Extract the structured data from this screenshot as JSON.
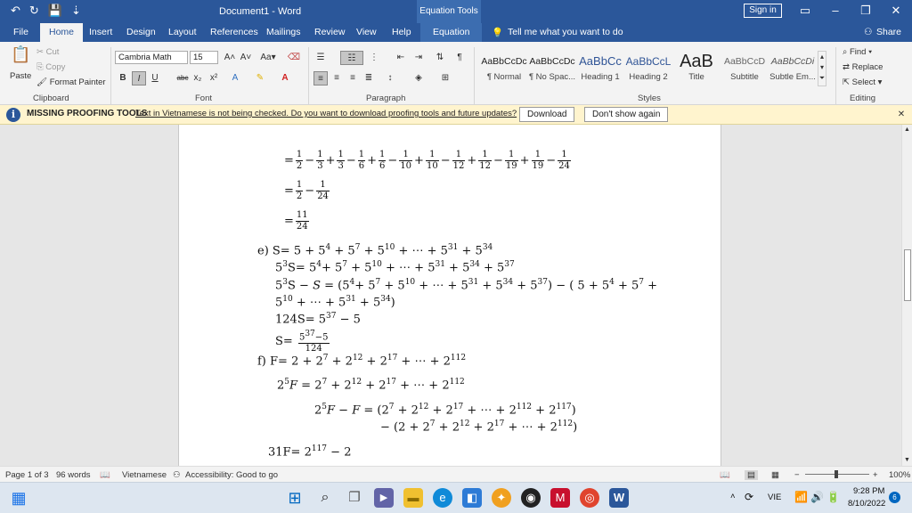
{
  "window": {
    "title": "Document1  -  Word",
    "context_tab": "Equation Tools",
    "signin": "Sign in",
    "qa": [
      "↶",
      "↻",
      "💾",
      "⇣"
    ]
  },
  "tabs": [
    "File",
    "Home",
    "Insert",
    "Design",
    "Layout",
    "References",
    "Mailings",
    "Review",
    "View",
    "Help",
    "Equation"
  ],
  "tellme": "Tell me what you want to do",
  "share": "Share",
  "ribbon": {
    "clipboard": {
      "paste": "Paste",
      "cut": "Cut",
      "copy": "Copy",
      "format_painter": "Format Painter",
      "label": "Clipboard"
    },
    "font": {
      "name": "Cambria Math",
      "size": "15",
      "label": "Font"
    },
    "paragraph": {
      "label": "Paragraph"
    },
    "styles": {
      "label": "Styles",
      "items": [
        {
          "preview": "AaBbCcDc",
          "name": "¶ Normal"
        },
        {
          "preview": "AaBbCcDc",
          "name": "¶ No Spac..."
        },
        {
          "preview": "AaBbCc",
          "name": "Heading 1"
        },
        {
          "preview": "AaBbCcL",
          "name": "Heading 2"
        },
        {
          "preview": "AaB",
          "name": "Title"
        },
        {
          "preview": "AaBbCcD",
          "name": "Subtitle"
        },
        {
          "preview": "AaBbCcDi",
          "name": "Subtle Em..."
        }
      ]
    },
    "editing": {
      "label": "Editing",
      "find": "Find",
      "replace": "Replace",
      "select": "Select"
    }
  },
  "infobar": {
    "title": "MISSING PROOFING TOOLS",
    "message": "Text in Vietnamese is not being checked. Do you want to download proofing tools and future updates?",
    "download": "Download",
    "dont_show": "Don't show again"
  },
  "document": {
    "eq_line1_prefix": "=",
    "eq_line1_fracs": [
      [
        "1",
        "2",
        "−"
      ],
      [
        "1",
        "3",
        "+"
      ],
      [
        "1",
        "3",
        "−"
      ],
      [
        "1",
        "6",
        "+"
      ],
      [
        "1",
        "6",
        "−"
      ],
      [
        "1",
        "10",
        "+"
      ],
      [
        "1",
        "10",
        "−"
      ],
      [
        "1",
        "12",
        "+"
      ],
      [
        "1",
        "12",
        "−"
      ],
      [
        "1",
        "19",
        "+"
      ],
      [
        "1",
        "19",
        "−"
      ],
      [
        "1",
        "24",
        ""
      ]
    ],
    "eq_line2_fracs": [
      [
        "1",
        "2",
        "−"
      ],
      [
        "1",
        "24",
        ""
      ]
    ],
    "eq_line3_frac": [
      "11",
      "24"
    ],
    "e_label": "e)",
    "f_label": "f)"
  },
  "status": {
    "page": "Page 1 of 3",
    "words": "96 words",
    "language": "Vietnamese",
    "accessibility": "Accessibility: Good to go",
    "zoom": "100%"
  },
  "tray": {
    "lang": "VIE",
    "time": "9:28 PM",
    "date": "8/10/2022",
    "badge": "6"
  }
}
